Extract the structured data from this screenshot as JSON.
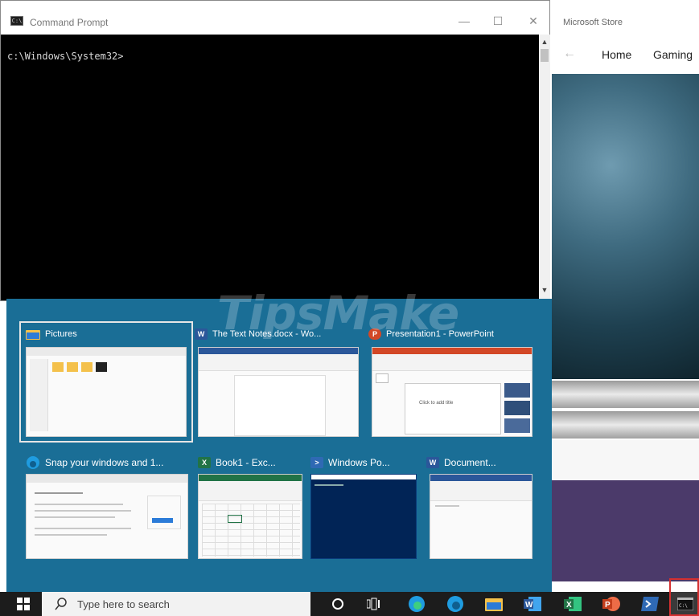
{
  "command_prompt": {
    "title": "Command Prompt",
    "icon_text": "C:\\",
    "prompt_line": "c:\\Windows\\System32>",
    "controls": {
      "minimize": "—",
      "maximize": "☐",
      "close": "✕"
    }
  },
  "store": {
    "title": "Microsoft Store",
    "back": "←",
    "nav": [
      "Home",
      "Gaming"
    ]
  },
  "watermark": "TipsMake",
  "task_view": {
    "windows": [
      {
        "title": "Pictures",
        "icon": "folder-icon",
        "color": "#2b7bd8"
      },
      {
        "title": "The Text Notes.docx - Wo...",
        "icon": "word-icon",
        "color": "#2b579a",
        "letter": "W"
      },
      {
        "title": "Presentation1 - PowerPoint",
        "icon": "powerpoint-icon",
        "color": "#d24726",
        "letter": "P"
      },
      {
        "title": "Snap your windows and 1...",
        "icon": "edge-icon",
        "color": "#1f9ce0"
      },
      {
        "title": "Book1 - Exc...",
        "icon": "excel-icon",
        "color": "#217346",
        "letter": "X"
      },
      {
        "title": "Windows Po...",
        "icon": "powershell-icon",
        "color": "#2f69b4",
        "letter": ">"
      },
      {
        "title": "Document...",
        "icon": "word-icon",
        "color": "#2b579a",
        "letter": "W"
      }
    ],
    "slide_placeholder": "Click to add title"
  },
  "taskbar": {
    "search_placeholder": "Type here to search",
    "apps": [
      "cortana-icon",
      "task-view-icon",
      "edge-icon",
      "edge-beta-icon",
      "file-explorer-icon",
      "word-icon",
      "excel-icon",
      "powerpoint-icon",
      "powershell-icon",
      "command-prompt-icon"
    ]
  }
}
